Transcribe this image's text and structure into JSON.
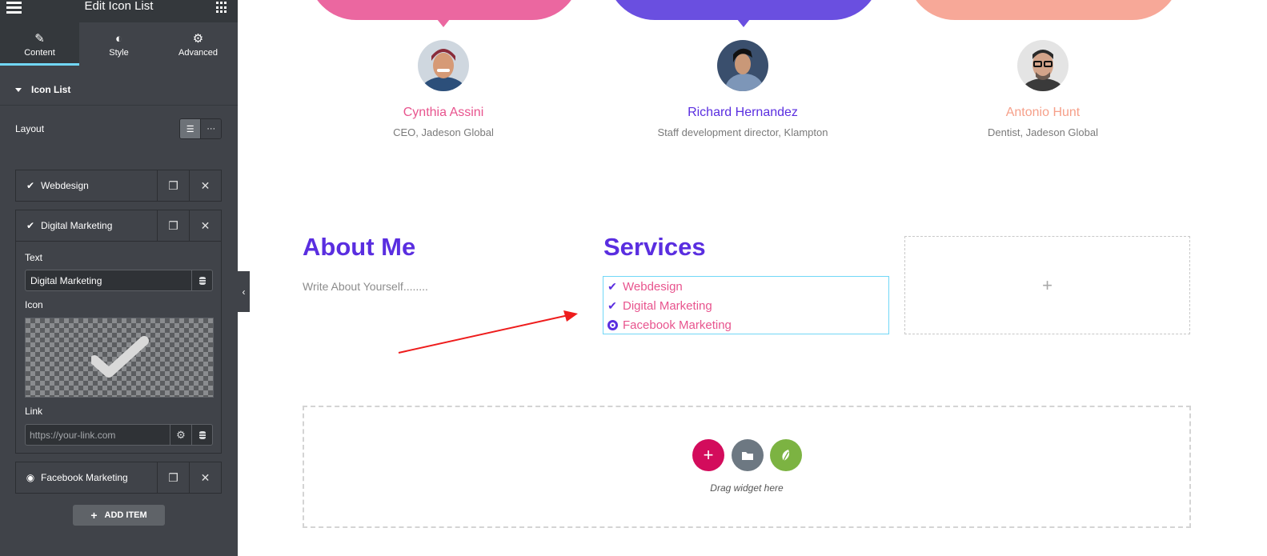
{
  "sidebar": {
    "title": "Edit Icon List",
    "tabs": [
      {
        "label": "Content",
        "icon": "pencil-icon"
      },
      {
        "label": "Style",
        "icon": "half-circle-icon"
      },
      {
        "label": "Advanced",
        "icon": "gear-icon"
      }
    ],
    "section_label": "Icon List",
    "layout_label": "Layout",
    "items": [
      {
        "label": "Webdesign",
        "icon": "check-icon"
      },
      {
        "label": "Digital Marketing",
        "icon": "check-icon"
      },
      {
        "label": "Facebook Marketing",
        "icon": "dot-circle-icon"
      }
    ],
    "editor": {
      "text_label": "Text",
      "text_value": "Digital Marketing",
      "icon_label": "Icon",
      "link_label": "Link",
      "link_placeholder": "https://your-link.com"
    },
    "add_item_label": "ADD ITEM"
  },
  "testimonials": [
    {
      "name": "Cynthia Assini",
      "role": "CEO, Jadeson Global",
      "color": "#e8548e"
    },
    {
      "name": "Richard Hernandez",
      "role": "Staff development director, Klampton",
      "color": "#5a2ee0"
    },
    {
      "name": "Antonio Hunt",
      "role": "Dentist, Jadeson Global",
      "color": "#f6a08a"
    }
  ],
  "about": {
    "heading": "About Me",
    "text": "Write About Yourself........"
  },
  "services": {
    "heading": "Services",
    "items": [
      "Webdesign",
      "Digital Marketing",
      "Facebook Marketing"
    ]
  },
  "drop_zone": {
    "text": "Drag widget here"
  },
  "colors": {
    "accent_purple": "#5a2ee0",
    "accent_pink": "#e8548e",
    "editor_dark": "#404349",
    "selection_blue": "#71d7f7"
  }
}
